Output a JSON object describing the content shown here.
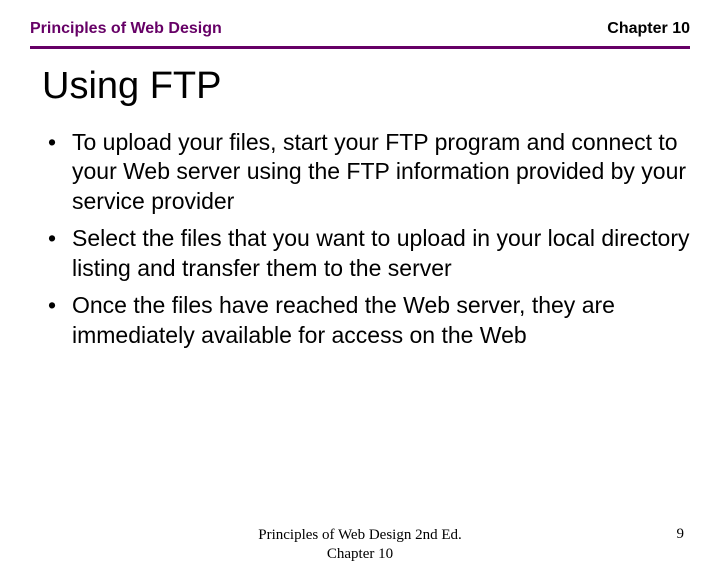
{
  "header": {
    "left": "Principles of Web Design",
    "right": "Chapter 10"
  },
  "title": "Using FTP",
  "bullets": [
    "To upload your files, start your FTP program and connect to your Web server using the FTP information provided by your service provider",
    "Select the files that you want to upload in your local directory listing and transfer them to the server",
    "Once the files have reached the Web server, they are immediately available for access on the Web"
  ],
  "footer": {
    "center_line1": "Principles of Web Design 2nd Ed.",
    "center_line2": "Chapter 10",
    "page_number": "9"
  }
}
